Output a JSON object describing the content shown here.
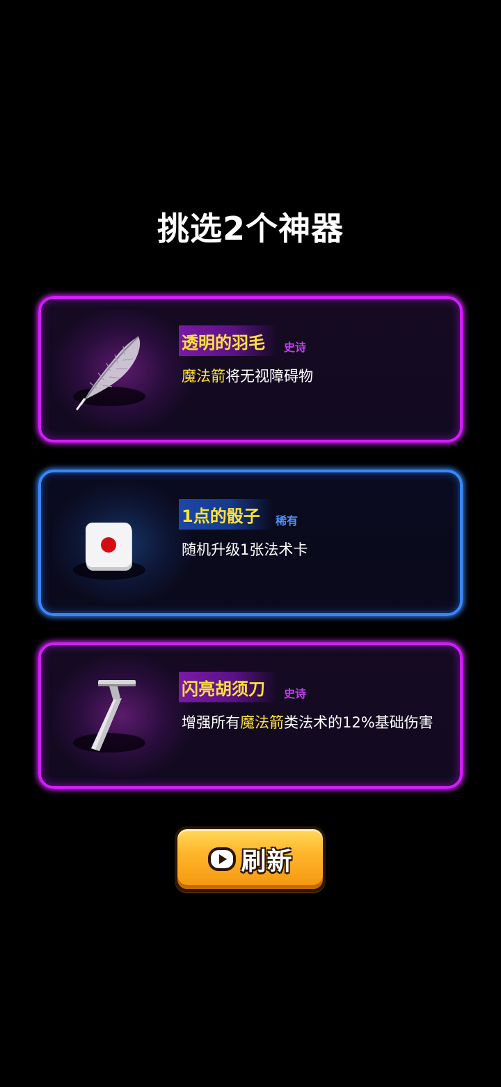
{
  "title": "挑选2个神器",
  "cards": [
    {
      "name": "透明的羽毛",
      "rarity": "史诗",
      "desc_highlight": "魔法箭",
      "desc_rest": "将无视障碍物",
      "icon": "feather-icon"
    },
    {
      "name": "1点的骰子",
      "rarity": "稀有",
      "desc": "随机升级1张法术卡",
      "icon": "dice-icon"
    },
    {
      "name": "闪亮胡须刀",
      "rarity": "史诗",
      "desc_pre": "增强所有",
      "desc_highlight": "魔法箭",
      "desc_rest": "类法术的12%基础伤害",
      "icon": "razor-icon"
    }
  ],
  "refresh_button": {
    "label": "刷新",
    "icon": "play-video-icon"
  },
  "colors": {
    "epic": "#d11dff",
    "rare": "#3a86ff",
    "highlight": "#ffe23b",
    "button": "#ffb52b"
  }
}
